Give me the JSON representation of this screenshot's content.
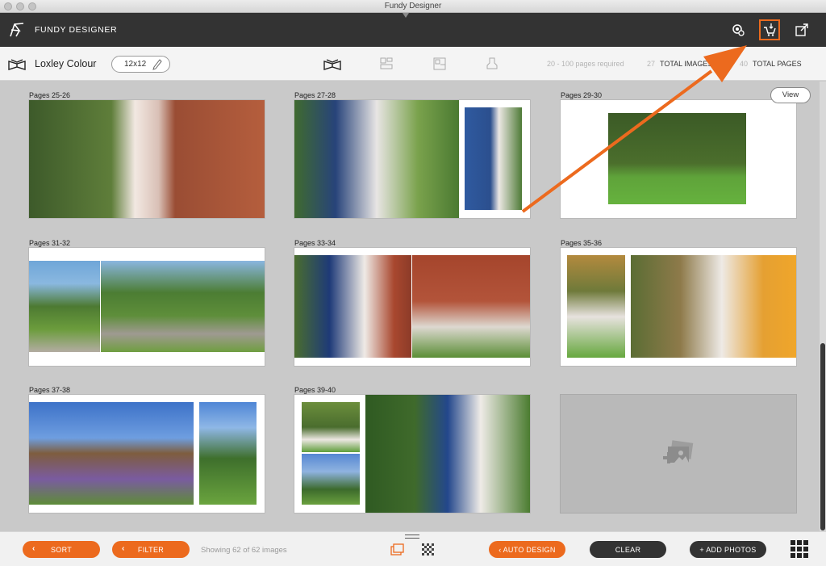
{
  "window": {
    "title": "Fundy Designer"
  },
  "appbar": {
    "app_name": "FUNDY DESIGNER",
    "icons": [
      "settings-gear-icon",
      "cart-download-icon",
      "external-share-icon"
    ]
  },
  "toolbar": {
    "album_name": "Loxley Colour",
    "album_size": "12x12",
    "view_tabs": [
      "album-spread-view-icon",
      "layout-view-icon",
      "template-view-icon",
      "stamp-view-icon"
    ],
    "pages_required": "20 - 100 pages required",
    "total_images_count": "27",
    "total_images_label": "TOTAL IMAGES",
    "total_pages_count": "40",
    "total_pages_label": "TOTAL PAGES"
  },
  "view_button_label": "View",
  "spreads": [
    {
      "label": "Pages 25-26"
    },
    {
      "label": "Pages 27-28"
    },
    {
      "label": "Pages 29-30"
    },
    {
      "label": "Pages 31-32"
    },
    {
      "label": "Pages 33-34"
    },
    {
      "label": "Pages 35-36"
    },
    {
      "label": "Pages 37-38"
    },
    {
      "label": "Pages 39-40"
    }
  ],
  "footer": {
    "sort_label": "SORT",
    "filter_label": "FILTER",
    "showing_text": "Showing 62 of 62 images",
    "auto_design_label": "AUTO DESIGN",
    "clear_label": "CLEAR",
    "add_photos_label": "+ ADD PHOTOS"
  },
  "colors": {
    "accent": "#ec6a1e",
    "header_bg": "#333333",
    "canvas_bg": "#c9c9c9"
  }
}
